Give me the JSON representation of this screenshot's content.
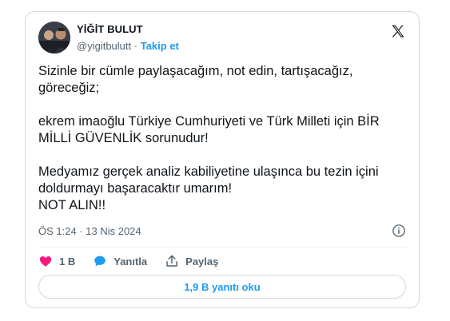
{
  "author": {
    "name": "YİĞİT BULUT",
    "handle": "@yigitbulutt",
    "separator": "·",
    "follow_label": "Takip et"
  },
  "tweet": {
    "paragraphs": [
      [
        "Sizinle bir cümle paylaşacağım, not edin, tartışacağız,",
        "göreceğiz;"
      ],
      [
        "ekrem imaoğlu Türkiye Cumhuriyeti ve Türk Milleti için BİR",
        "MİLLİ GÜVENLİK sorunudur!"
      ],
      [
        "Medyamız gerçek analiz kabiliyetine ulaşınca bu tezin içini",
        "doldurmayı başaracaktır umarım!",
        "NOT ALIN!!"
      ]
    ],
    "timestamp": "ÖS 1:24 · 13 Nis 2024"
  },
  "actions": {
    "like_count": "1 B",
    "reply_label": "Yanıtla",
    "share_label": "Paylaş"
  },
  "replies_button": "1,9 B yanıtı oku",
  "colors": {
    "accent": "#1d9bf0",
    "like": "#f91880",
    "secondary_text": "#536471",
    "border": "#cfd9de"
  },
  "icons": [
    "x-logo-icon",
    "info-icon",
    "heart-icon",
    "reply-bubble-icon",
    "share-icon"
  ]
}
